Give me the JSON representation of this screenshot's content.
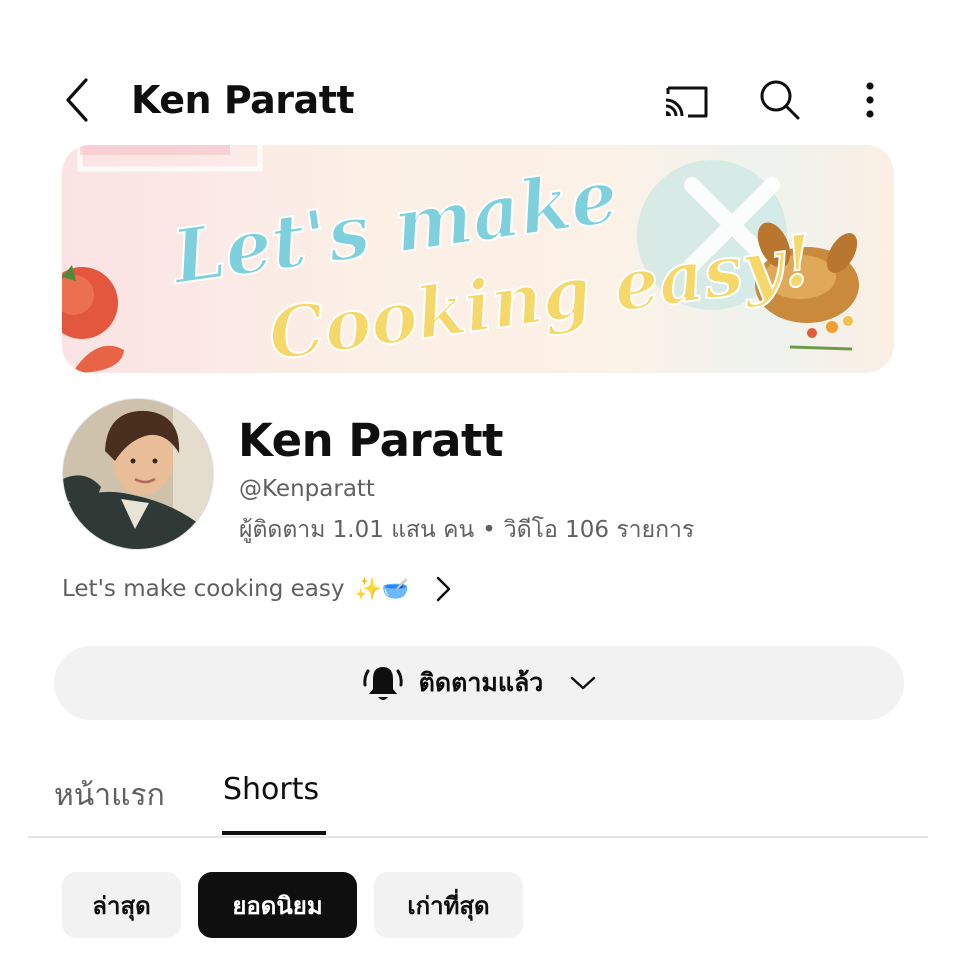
{
  "header": {
    "title": "Ken Paratt",
    "icons": [
      "back-icon",
      "cast-icon",
      "search-icon",
      "more-vert-icon"
    ]
  },
  "banner": {
    "line1": "Let's make",
    "line2": "Cooking easy!"
  },
  "channel": {
    "name": "Ken Paratt",
    "handle": "@Kenparatt",
    "subscribers": "ผู้ติดตาม 1.01 แสน คน",
    "separator": "•",
    "videos": "วิดีโอ 106 รายการ",
    "description": "Let's make cooking easy",
    "description_emoji": "✨🥣"
  },
  "subscribe": {
    "label": "ติดตามแล้ว"
  },
  "tabs": [
    {
      "label": "หน้าแรก",
      "active": false
    },
    {
      "label": "Shorts",
      "active": true
    }
  ],
  "chips": [
    {
      "label": "ล่าสุด",
      "selected": false
    },
    {
      "label": "ยอดนิยม",
      "selected": true
    },
    {
      "label": "เก่าที่สุด",
      "selected": false
    }
  ],
  "colors": {
    "text_primary": "#0f0f0f",
    "text_secondary": "#606060",
    "chip_bg": "#f2f2f2",
    "chip_selected_bg": "#0f0f0f",
    "banner_teal": "#7ccfd9",
    "banner_yellow": "#f5d86a"
  }
}
